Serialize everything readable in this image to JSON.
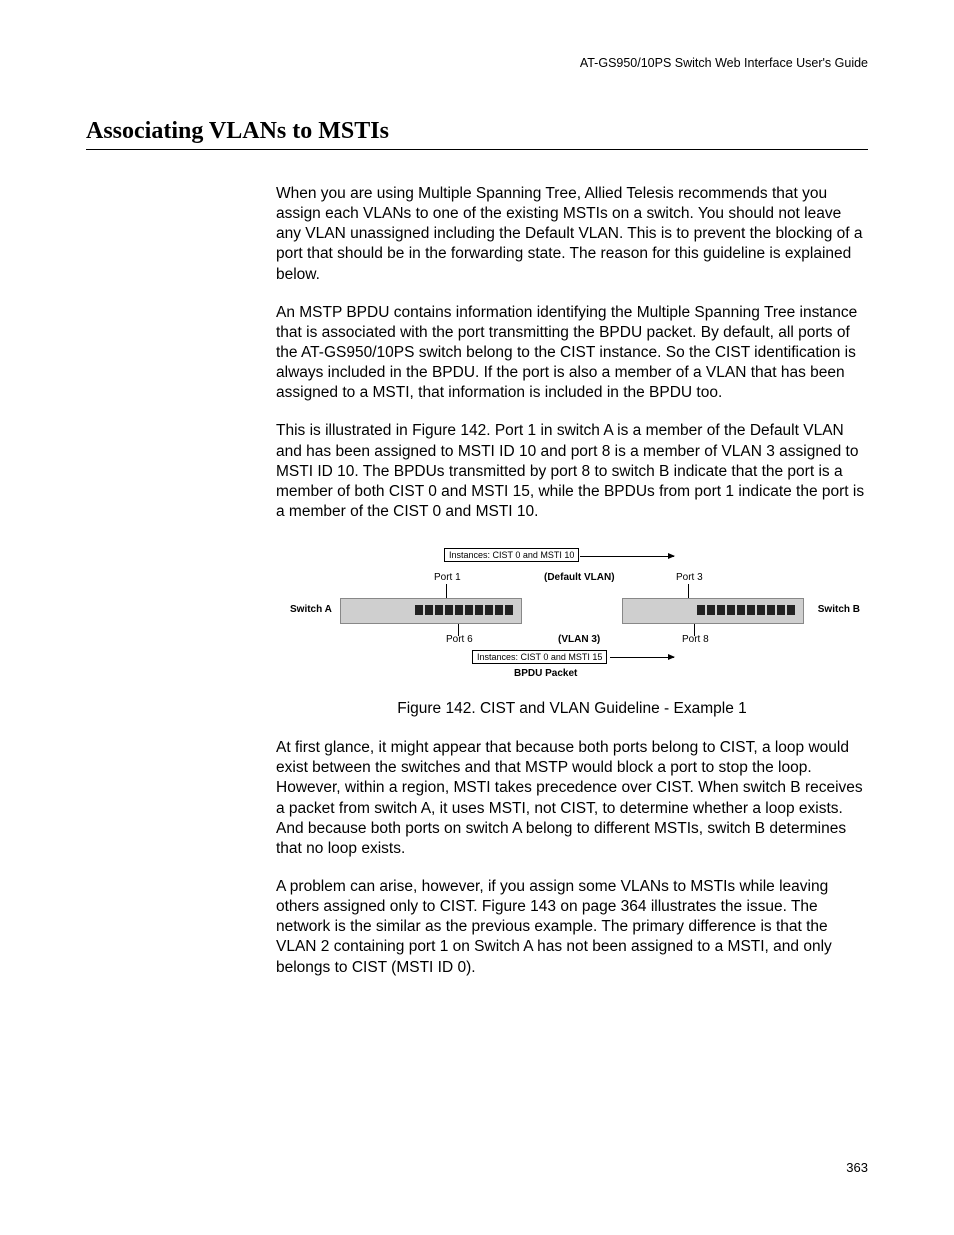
{
  "header": {
    "running": "AT-GS950/10PS Switch Web Interface User's Guide"
  },
  "title": "Associating VLANs to MSTIs",
  "paragraphs": {
    "p1": "When you are using Multiple Spanning Tree, Allied Telesis recommends that you assign each VLANs to one of the existing MSTIs on a switch. You should not leave any VLAN unassigned including the Default VLAN. This is to prevent the blocking of a port that should be in the forwarding state. The reason for this guideline is explained below.",
    "p2": "An MSTP BPDU contains information identifying the Multiple Spanning Tree instance that is associated with the port transmitting the BPDU packet. By default, all ports of the AT-GS950/10PS switch belong to the CIST instance. So the CIST identification is always included in the BPDU. If the port is also a member of a VLAN that has been assigned to a MSTI, that information is included in the BPDU too.",
    "p3": "This is illustrated in Figure 142. Port 1 in switch A is a member of the Default VLAN and has been assigned to MSTI ID 10 and port 8 is a member of VLAN 3 assigned to MSTI ID 10. The BPDUs transmitted by port 8 to switch B indicate that the port is a member of both CIST 0 and MSTI 15, while the BPDUs from port 1 indicate the port is a member of the CIST 0 and MSTI 10.",
    "p4": "At first glance, it might appear that because both ports belong to CIST, a loop would exist between the switches and that MSTP would block a port to stop the loop. However, within a region, MSTI takes precedence over CIST. When switch B receives a packet from switch A, it uses MSTI, not CIST, to determine whether a loop exists. And because both ports on switch A belong to different MSTIs, switch B determines that no loop exists.",
    "p5": "A problem can arise, however, if you assign some VLANs to MSTIs while leaving others assigned only to CIST. Figure 143 on page 364 illustrates the issue. The network is the similar as the previous example. The primary difference is that the VLAN 2 containing port 1 on Switch A has not been assigned to a MSTI, and only belongs to CIST (MSTI ID 0)."
  },
  "figure": {
    "caption": "Figure 142. CIST and VLAN Guideline - Example 1",
    "switch_a": "Switch A",
    "switch_b": "Switch B",
    "port1": "Port 1",
    "port3": "Port 3",
    "port6": "Port 6",
    "port8": "Port 8",
    "default_vlan": "(Default VLAN)",
    "vlan3": "(VLAN 3)",
    "inst_top": "Instances: CIST 0 and MSTI 10",
    "inst_bot": "Instances: CIST 0 and MSTI 15",
    "bpdu": "BPDU Packet"
  },
  "page_number": "363"
}
